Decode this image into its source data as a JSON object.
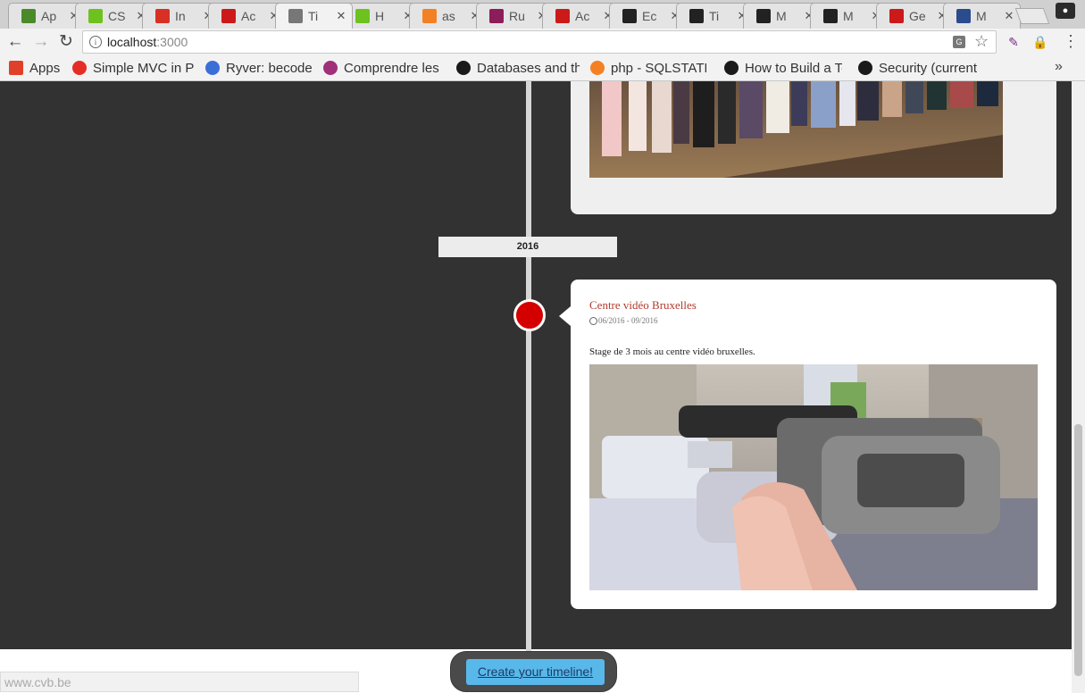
{
  "browser": {
    "tabs": [
      {
        "title": "Ap",
        "icon": "cube-icon",
        "color": "#4a8a2a"
      },
      {
        "title": "CS",
        "icon": "w3schools-icon",
        "color": "#6dc21f"
      },
      {
        "title": "In",
        "icon": "gmail-icon",
        "color": "#d93025"
      },
      {
        "title": "Ac",
        "icon": "bird-icon",
        "color": "#cc1a1a"
      },
      {
        "title": "Ti",
        "icon": "document-icon",
        "color": "#777777",
        "active": true
      },
      {
        "title": "H",
        "icon": "w3schools-icon",
        "color": "#6dc21f"
      },
      {
        "title": "as",
        "icon": "stackoverflow-icon",
        "color": "#f48024"
      },
      {
        "title": "Ru",
        "icon": "info-icon",
        "color": "#8c1d5a"
      },
      {
        "title": "Ac",
        "icon": "bird-icon",
        "color": "#cc1a1a"
      },
      {
        "title": "Ec",
        "icon": "github-icon",
        "color": "#222222"
      },
      {
        "title": "Ti",
        "icon": "github-icon",
        "color": "#222222"
      },
      {
        "title": "M",
        "icon": "github-icon",
        "color": "#222222"
      },
      {
        "title": "M",
        "icon": "github-icon",
        "color": "#222222"
      },
      {
        "title": "Ge",
        "icon": "bird-icon",
        "color": "#cc1a1a"
      },
      {
        "title": "M",
        "icon": "translate-icon",
        "color": "#2a4c8c"
      }
    ],
    "address": {
      "host": "localhost",
      "port": ":3000"
    },
    "bookmarks": [
      {
        "label": "Apps",
        "icon": "apps-grid-icon",
        "color": "#e0402a"
      },
      {
        "label": "Simple MVC in PI",
        "icon": "youtube-icon",
        "color": "#e52d27"
      },
      {
        "label": "Ryver: becode",
        "icon": "ryver-icon",
        "color": "#3a6fd8"
      },
      {
        "label": "Comprendre les",
        "icon": "spiral-icon",
        "color": "#a0307a"
      },
      {
        "label": "Databases and th",
        "icon": "symfony-icon",
        "color": "#1a1a1a"
      },
      {
        "label": "php - SQLSTATE[",
        "icon": "stackoverflow-icon",
        "color": "#f48024"
      },
      {
        "label": "How to Build a To",
        "icon": "symfony-icon",
        "color": "#1a1a1a"
      },
      {
        "label": "Security (current",
        "icon": "symfony-icon",
        "color": "#1a1a1a"
      }
    ],
    "bookmarks_more": "»",
    "status_url": "www.cvb.be"
  },
  "timeline": {
    "year": "2016",
    "entry": {
      "title": "Centre vidéo Bruxelles",
      "dates": "06/2016 - 09/2016",
      "description": "Stage de 3 mois au centre vidéo bruxelles."
    },
    "cta_label": "Create your timeline!",
    "marker_color": "#d40000",
    "title_color": "#b23b2e",
    "background_color": "#323232"
  }
}
